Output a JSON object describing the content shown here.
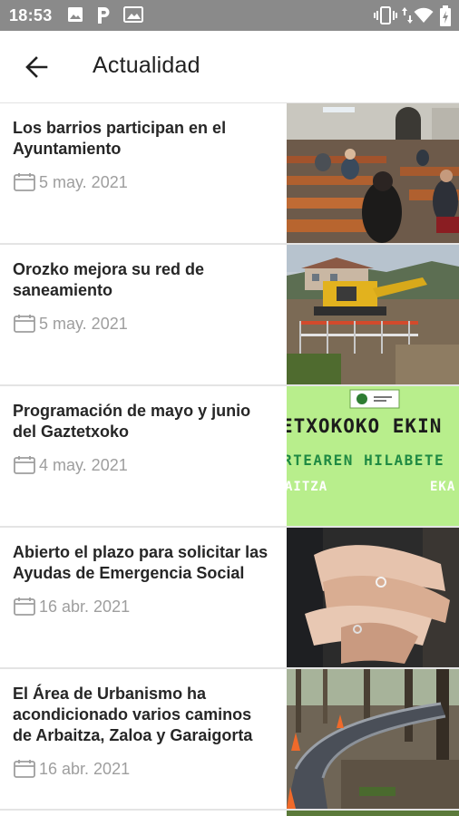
{
  "status_bar": {
    "time": "18:53",
    "left_icons": [
      "image-icon",
      "p-icon",
      "gallery-icon"
    ],
    "right_icons": [
      "vibrate-icon",
      "data-arrows-icon",
      "wifi-icon",
      "battery-icon"
    ]
  },
  "app_bar": {
    "title": "Actualidad",
    "back_icon": "arrow-left-icon"
  },
  "news": [
    {
      "title": "Los barrios participan en el Ayuntamiento",
      "date": "5 may. 2021",
      "thumb": "church-meeting"
    },
    {
      "title": "Orozko mejora su red de saneamiento",
      "date": "5 may. 2021",
      "thumb": "excavator-works"
    },
    {
      "title": "Programación de mayo y junio del Gaztetxoko",
      "date": "4 may. 2021",
      "thumb": "green-poster",
      "thumb_text": {
        "line1": "ETXOKOKO EKIN",
        "line2": "RTEAREN HILABETE",
        "line3_left": "AITZA",
        "line3_right": "EKA"
      }
    },
    {
      "title": "Abierto el plazo para solicitar las Ayudas de Emergencia Social",
      "date": "16 abr. 2021",
      "thumb": "hands"
    },
    {
      "title": "El Área de Urbanismo ha acondicionado varios caminos de Arbaitza, Zaloa y Garaigorta",
      "date": "16 abr. 2021",
      "thumb": "forest-path"
    }
  ],
  "colors": {
    "status_bar": "#8a8a8a",
    "title_text": "#212121",
    "date_text": "#9e9e9e",
    "divider": "#e4e4e4",
    "poster_green": "#b8ee8c"
  }
}
